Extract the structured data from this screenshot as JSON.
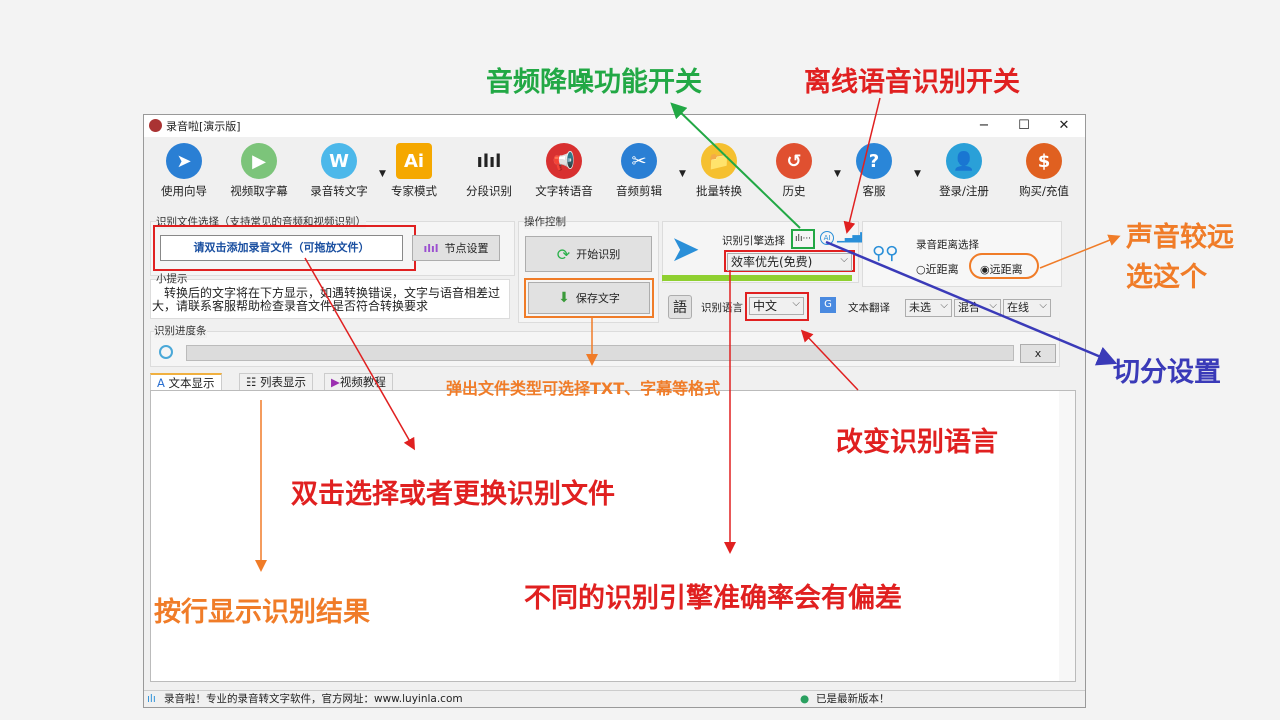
{
  "window": {
    "title": "录音啦[演示版]",
    "minimize": "−",
    "maximize": "☐",
    "close": "✕"
  },
  "toolbar": [
    {
      "label": "使用向导",
      "icon": "navigation-arrow-icon",
      "color": "#2a7fd4"
    },
    {
      "label": "视频取字幕",
      "icon": "video-clapper-icon",
      "color": "#7cc47a"
    },
    {
      "label": "录音转文字",
      "icon": "w-logo-icon",
      "color": "#4cb8ea",
      "caret": true
    },
    {
      "label": "专家模式",
      "icon": "ai-icon",
      "color": "#f5a800"
    },
    {
      "label": "分段识别",
      "icon": "waveform-icon",
      "color": "#222"
    },
    {
      "label": "文字转语音",
      "icon": "megaphone-icon",
      "color": "#d83030"
    },
    {
      "label": "音频剪辑",
      "icon": "scissors-icon",
      "color": "#2a7fd4",
      "caret": true
    },
    {
      "label": "批量转换",
      "icon": "folder-icon",
      "color": "#f5c030"
    },
    {
      "label": "历史",
      "icon": "history-clock-icon",
      "color": "#e05030",
      "caret": true
    },
    {
      "label": "客服",
      "icon": "help-icon",
      "color": "#2a86d8",
      "caret": true
    },
    {
      "label": "登录/注册",
      "icon": "user-icon",
      "color": "#2aa0d8"
    },
    {
      "label": "购买/充值",
      "icon": "dollar-icon",
      "color": "#e06020"
    }
  ],
  "file_group": {
    "label": "识别文件选择（支持常见的音频和视频识别）",
    "file_input": "请双击添加录音文件（可拖放文件）",
    "node_button": "节点设置"
  },
  "tips": {
    "label": "小提示",
    "text": "　转换后的文字将在下方显示，如遇转换错误，文字与语音相差过大，请联系客服帮助检查录音文件是否符合转换要求"
  },
  "ops": {
    "label": "操作控制",
    "start": "开始识别",
    "save": "保存文字"
  },
  "engine": {
    "label": "识别引擎选择",
    "selected": "效率优先(免费)",
    "noise_icon": "ılı···",
    "ai_icon": "AI"
  },
  "distance": {
    "label": "录音距离选择",
    "near": "近距离",
    "far": "远距离",
    "selected": "far"
  },
  "lang": {
    "icon_text": "語",
    "label": "识别语言",
    "selected": "中文",
    "translate_label": "文本翻译",
    "t1": "未选",
    "t2": "混合",
    "t3": "在线"
  },
  "progress": {
    "label": "识别进度条",
    "value": 0,
    "cancel": "x"
  },
  "tabs": [
    {
      "label": "文本显示",
      "active": true
    },
    {
      "label": "列表显示"
    },
    {
      "label": "视频教程"
    }
  ],
  "status": {
    "left": "录音啦！专业的录音转文字软件，官方网址：www.luyinla.com",
    "right": "已是最新版本！"
  },
  "annotations": {
    "noise": "音频降噪功能开关",
    "offline": "离线语音识别开关",
    "far": "声音较远\n选这个",
    "split": "切分设置",
    "save_hint": "弹出文件类型可选择TXT、字幕等格式",
    "lang": "改变识别语言",
    "file": "双击选择或者更换识别文件",
    "rows": "按行显示识别结果",
    "engine": "不同的识别引擎准确率会有偏差"
  },
  "colors": {
    "green": "#22a845",
    "red": "#e02020",
    "orange": "#f07c28",
    "blue": "#3a3ab8"
  }
}
